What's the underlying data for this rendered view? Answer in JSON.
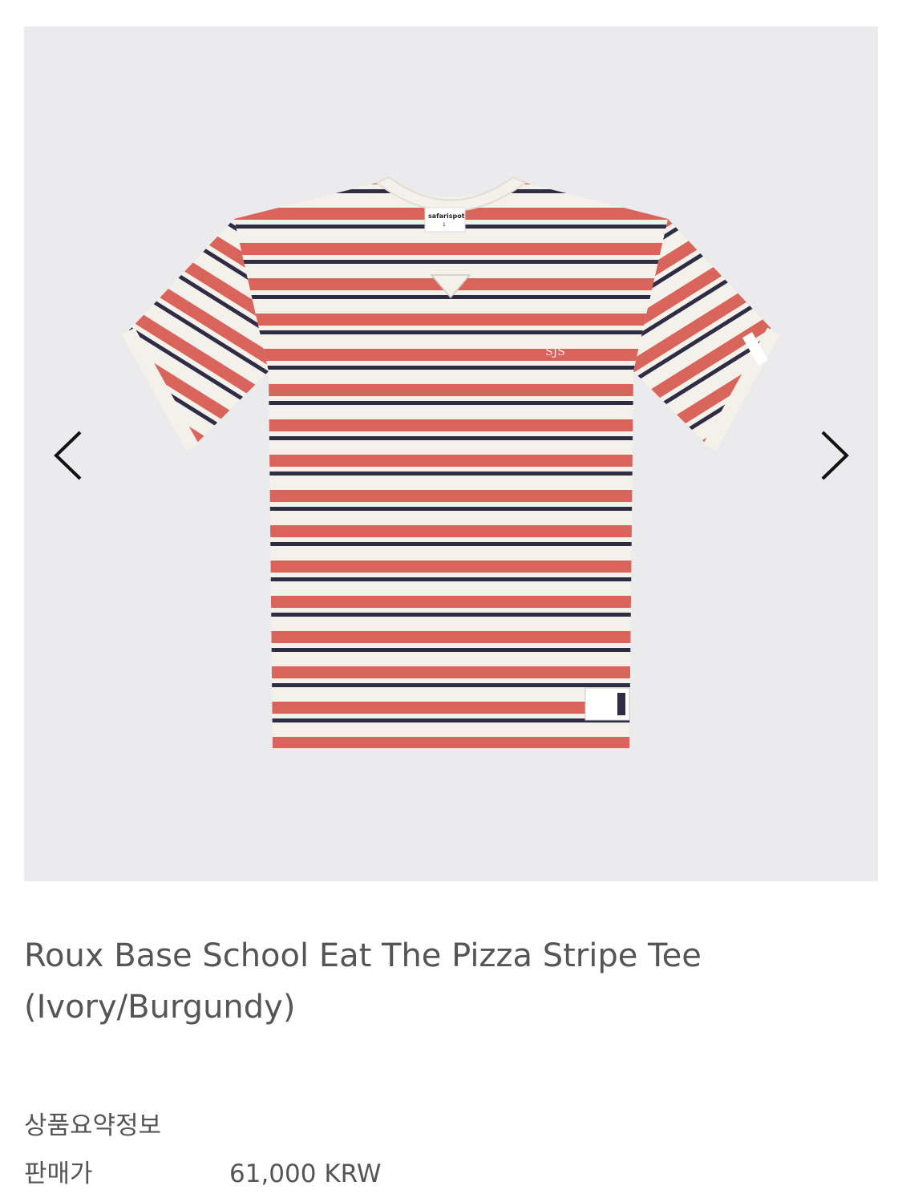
{
  "gallery": {
    "image_alt": "Striped t-shirt product photo",
    "shirt_label_brand": "safarispot",
    "shirt_label_size": "1",
    "prev_icon": "chevron-left-icon",
    "next_icon": "chevron-right-icon",
    "colors": {
      "background": "#ebebed",
      "stripe_red": "#d9645c",
      "stripe_ivory": "#f4f1ea",
      "stripe_navy": "#2f2d45"
    }
  },
  "product": {
    "title": "Roux Base School Eat The Pizza Stripe Tee (Ivory/Burgundy)"
  },
  "summary": {
    "heading": "상품요약정보",
    "price_label": "판매가",
    "price_value": "61,000 KRW"
  }
}
